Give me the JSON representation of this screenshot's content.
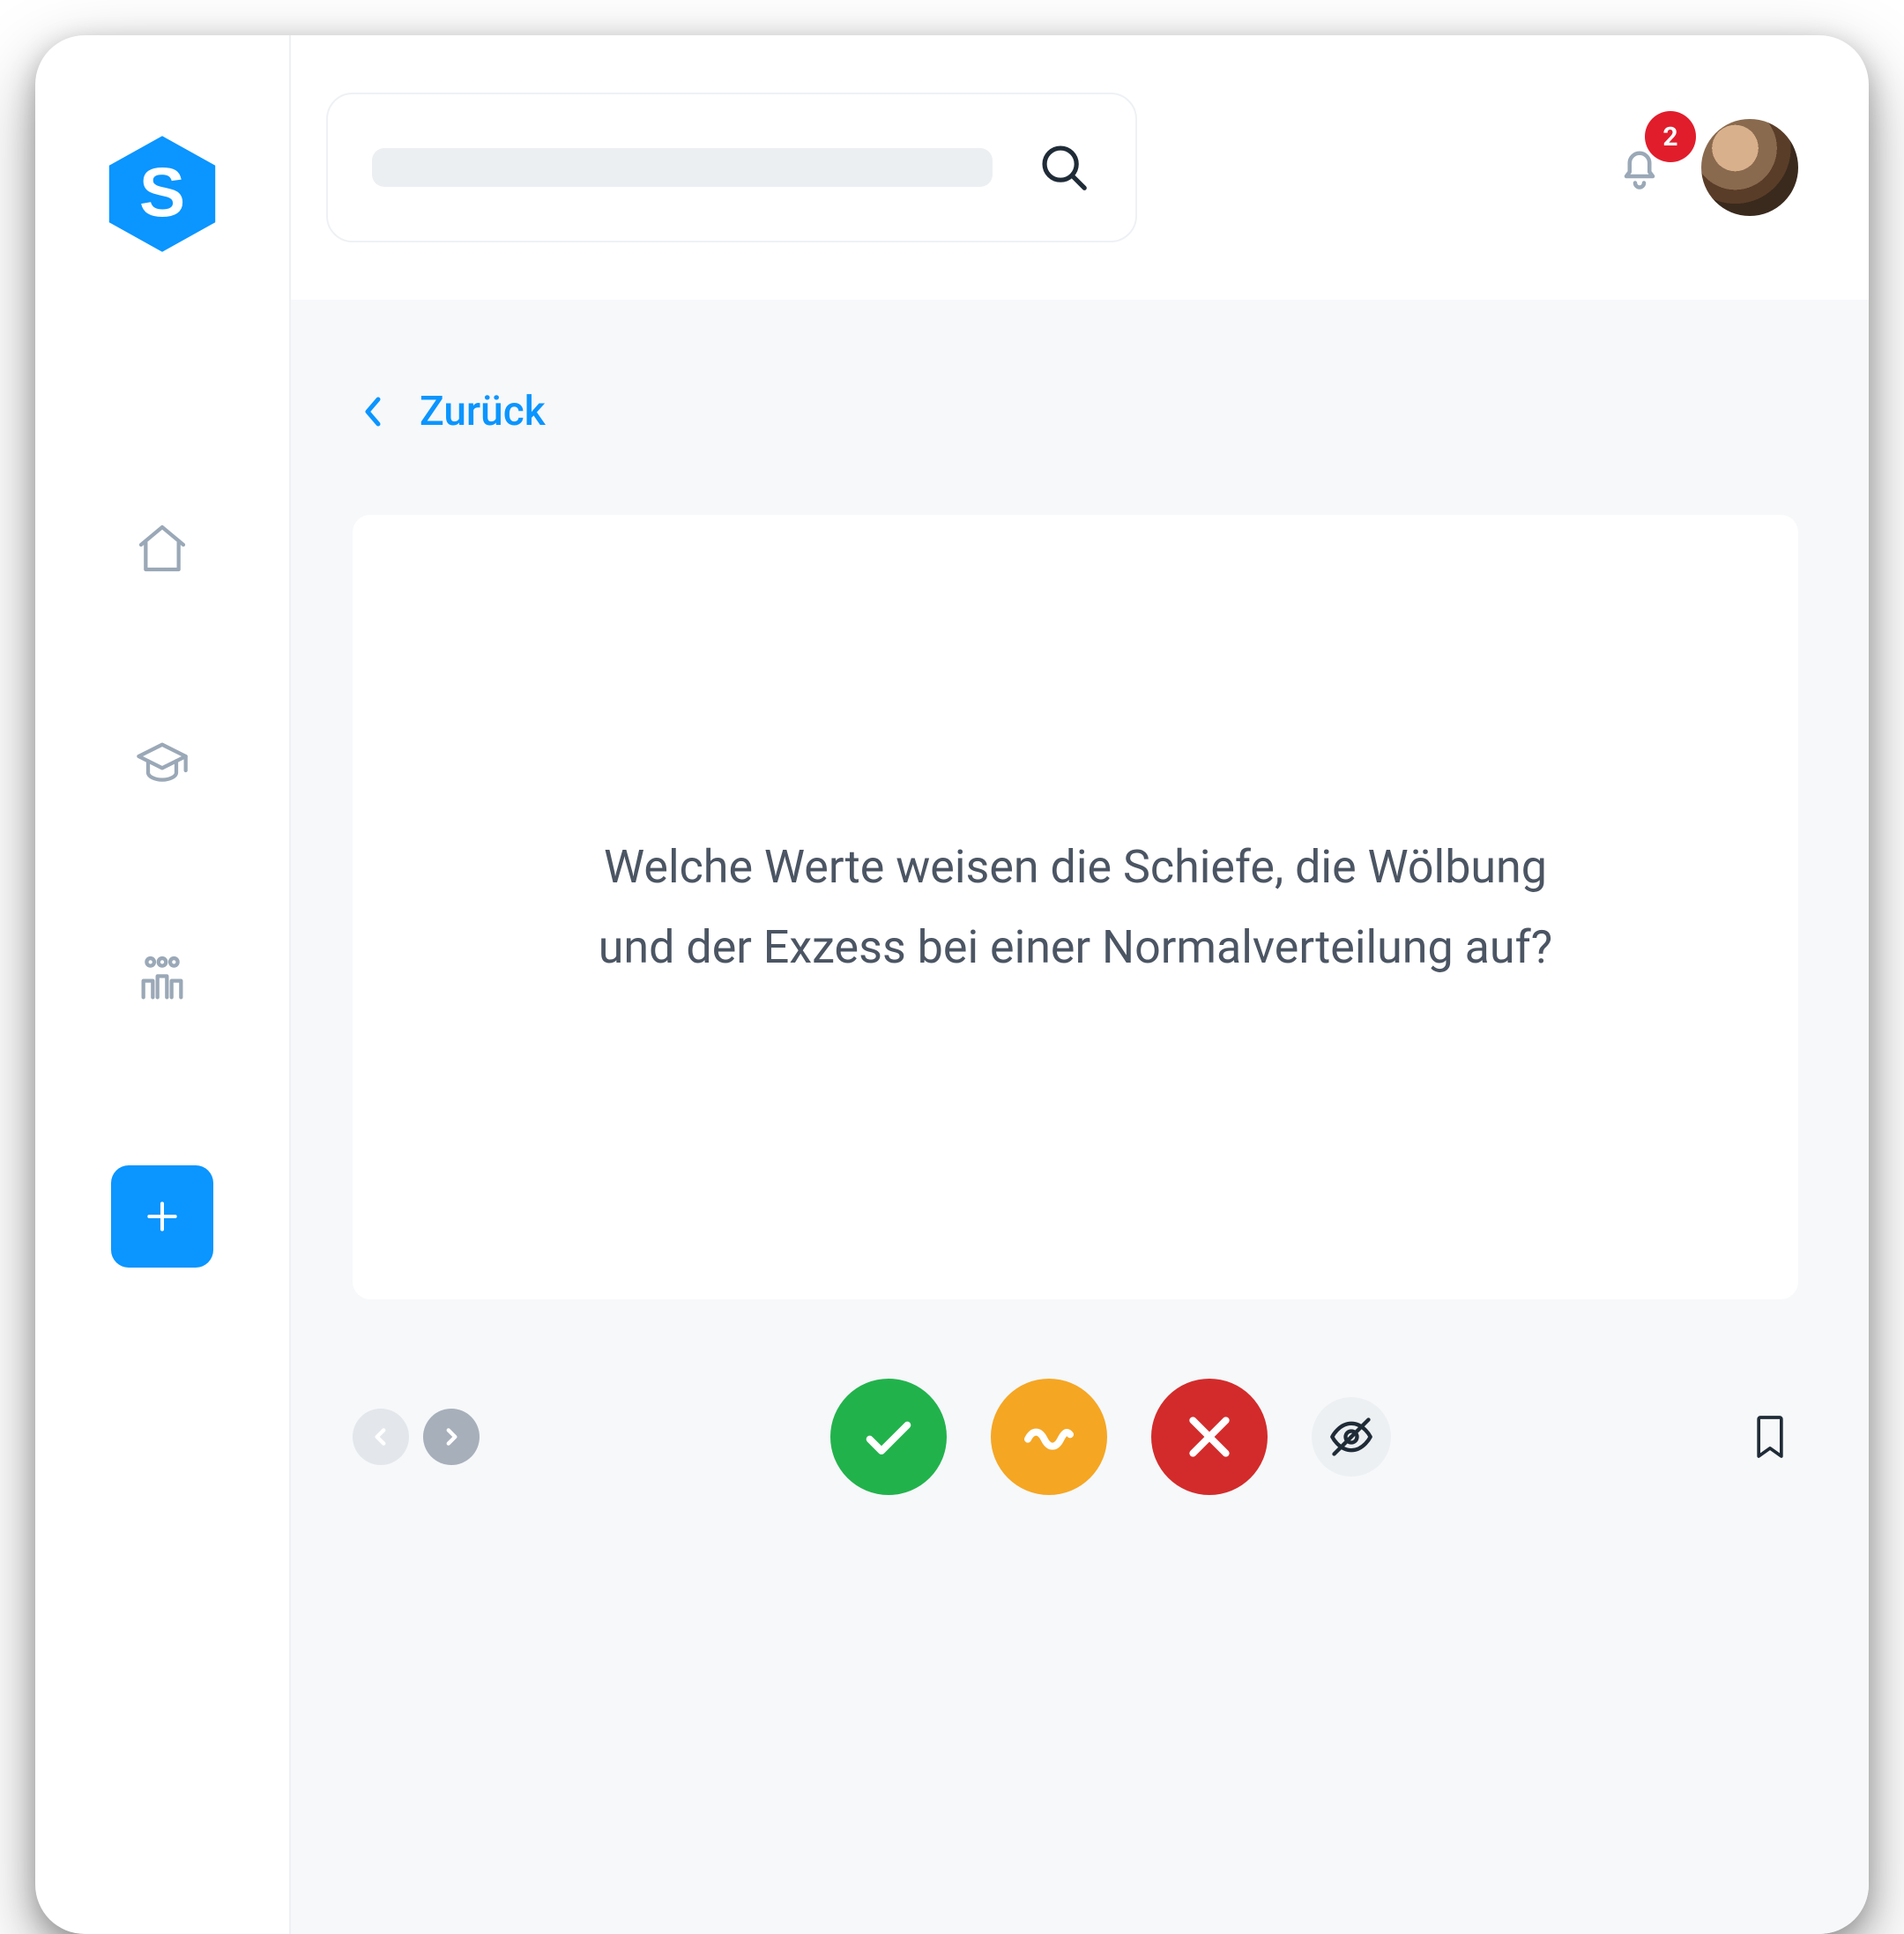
{
  "colors": {
    "primary": "#0a95ff",
    "danger": "#e11d2c",
    "success": "#22b24c",
    "warning": "#f5a623",
    "wrong": "#d32b2b",
    "mutedIcon": "#9aa8b7",
    "pageBg": "#f6f8fa"
  },
  "sidebar": {
    "logo_letter": "S",
    "items": [
      {
        "icon": "home-icon"
      },
      {
        "icon": "graduation-cap-icon"
      },
      {
        "icon": "people-icon"
      }
    ],
    "add_button": {
      "icon": "plus-icon"
    }
  },
  "topbar": {
    "search": {
      "placeholder": ""
    },
    "notifications": {
      "count": "2"
    }
  },
  "content": {
    "back_label": "Zurück",
    "card": {
      "question": "Welche Werte weisen die Schiefe, die Wölbung und der Exzess bei einer Normalverteilung auf?"
    },
    "pager": {
      "prev_enabled": false,
      "next_enabled": true
    },
    "actions": {
      "correct": "check-icon",
      "partial": "wave-icon",
      "wrong": "cross-icon",
      "hide": "eye-off-icon"
    },
    "bookmark": {
      "icon": "bookmark-icon",
      "active": false
    }
  }
}
